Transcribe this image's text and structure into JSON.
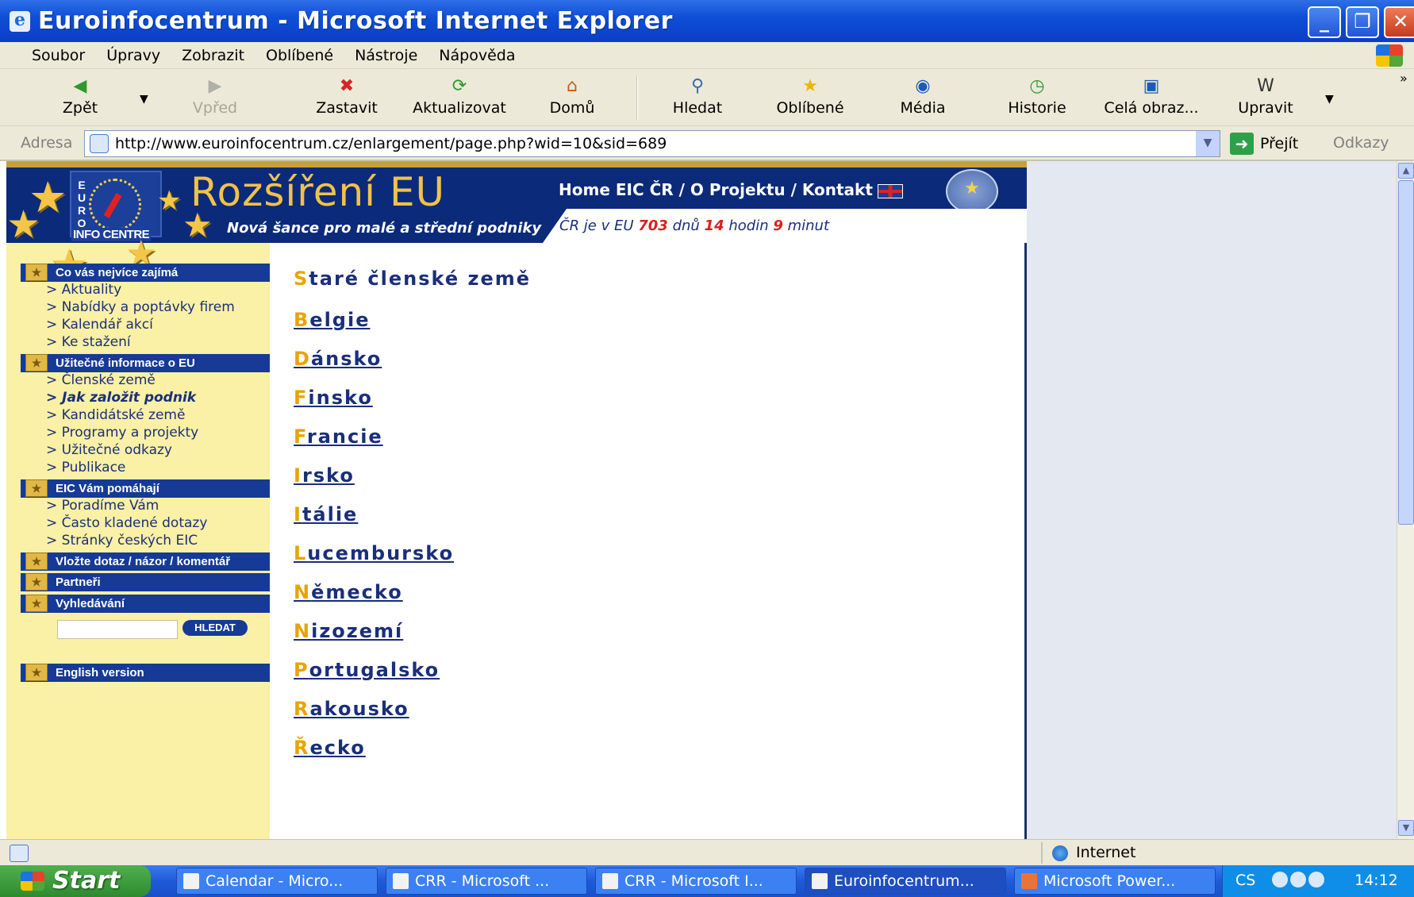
{
  "window": {
    "title": "Euroinfocentrum - Microsoft Internet Explorer"
  },
  "menu": [
    "Soubor",
    "Úpravy",
    "Zobrazit",
    "Oblíbené",
    "Nástroje",
    "Nápověda"
  ],
  "toolbar": {
    "back": "Zpět",
    "forward": "Vpřed",
    "stop": "Zastavit",
    "refresh": "Aktualizovat",
    "home": "Domů",
    "search": "Hledat",
    "favorites": "Oblíbené",
    "media": "Média",
    "history": "Historie",
    "fullscreen": "Celá obraz...",
    "edit": "Upravit"
  },
  "address": {
    "label": "Adresa",
    "url": "http://www.euroinfocentrum.cz/enlargement/page.php?wid=10&sid=689",
    "go": "Přejít",
    "links": "Odkazy"
  },
  "banner": {
    "vertical_text": "EURO",
    "infocentre": "INFO CENTRE",
    "title": "Rozšíření EU",
    "subtitle": "Nová šance pro malé a střední podniky",
    "nav": "Home EIC ČR / O Projektu / Kontakt",
    "countdown_prefix": "ČR je v EU",
    "days": "703",
    "days_label": "dnů",
    "hours": "14",
    "hours_label": "hodin",
    "minutes": "9",
    "minutes_label": "minut"
  },
  "sidebar": {
    "sections": [
      {
        "title": "Co vás nejvíce zajímá",
        "items": [
          "> Aktuality",
          "> Nabídky a poptávky firem",
          "> Kalendář akcí",
          "> Ke stažení"
        ]
      },
      {
        "title": "Užitečné informace o EU",
        "items": [
          "> Členské země",
          "> Jak založit podnik",
          "> Kandidátské země",
          "> Programy a projekty",
          "> Užitečné odkazy",
          "> Publikace"
        ]
      },
      {
        "title": "EIC Vám pomáhají",
        "items": [
          "> Poradíme Vám",
          "> Často kladené dotazy",
          "> Stránky českých EIC"
        ]
      },
      {
        "title": "Vložte dotaz / názor / komentář",
        "items": []
      },
      {
        "title": "Partneři",
        "items": []
      },
      {
        "title": "Vyhledávání",
        "items": []
      },
      {
        "title": "English version",
        "items": []
      }
    ],
    "search_button": "HLEDAT"
  },
  "content": {
    "heading_first": "S",
    "heading_rest": "taré členské země",
    "countries": [
      {
        "first": "B",
        "rest": "elgie"
      },
      {
        "first": "D",
        "rest": "ánsko"
      },
      {
        "first": "F",
        "rest": "insko"
      },
      {
        "first": "F",
        "rest": "rancie"
      },
      {
        "first": "I",
        "rest": "rsko"
      },
      {
        "first": "I",
        "rest": "tálie"
      },
      {
        "first": "L",
        "rest": "ucembursko"
      },
      {
        "first": "N",
        "rest": "ěmecko"
      },
      {
        "first": "N",
        "rest": "izozemí"
      },
      {
        "first": "P",
        "rest": "ortugalsko"
      },
      {
        "first": "R",
        "rest": "akousko"
      },
      {
        "first": "Ř",
        "rest": "ecko"
      }
    ]
  },
  "status": {
    "zone": "Internet"
  },
  "taskbar": {
    "start": "Start",
    "tasks": [
      "Calendar - Micro...",
      "CRR - Microsoft ...",
      "CRR - Microsoft I...",
      "Euroinfocentrum...",
      "Microsoft Power..."
    ],
    "lang": "CS",
    "clock": "14:12"
  }
}
